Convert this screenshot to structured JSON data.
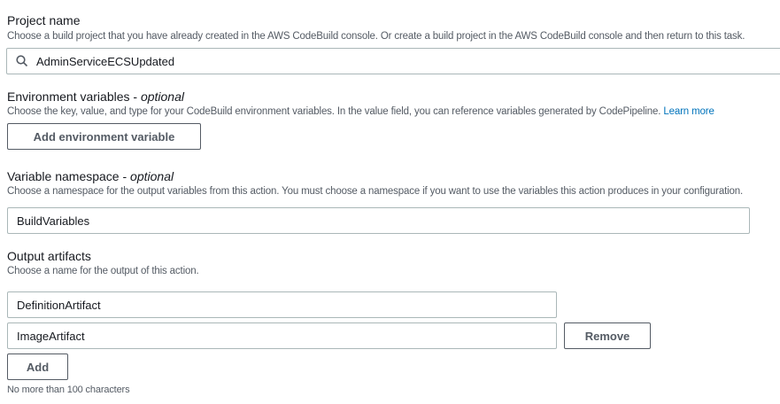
{
  "project": {
    "label": "Project name",
    "description": "Choose a build project that you have already created in the AWS CodeBuild console. Or create a build project in the AWS CodeBuild console and then return to this task.",
    "value": "AdminServiceECSUpdated",
    "icon": "search-icon"
  },
  "env": {
    "label": "Environment variables - ",
    "optional": "optional",
    "description": "Choose the key, value, and type for your CodeBuild environment variables. In the value field, you can reference variables generated by CodePipeline. ",
    "learn_more": "Learn more",
    "button": "Add environment variable"
  },
  "namespace": {
    "label": "Variable namespace - ",
    "optional": "optional",
    "description": "Choose a namespace for the output variables from this action. You must choose a namespace if you want to use the variables this action produces in your configuration.",
    "value": "BuildVariables"
  },
  "artifacts": {
    "label": "Output artifacts",
    "description": "Choose a name for the output of this action.",
    "items": [
      "DefinitionArtifact",
      "ImageArtifact"
    ],
    "remove": "Remove",
    "add": "Add",
    "hint": "No more than 100 characters"
  }
}
